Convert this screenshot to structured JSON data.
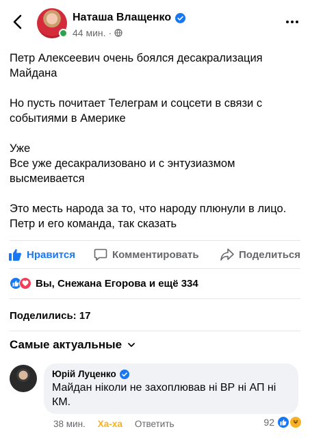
{
  "header": {
    "author": "Наташа Влащенко",
    "time": "44 мин.",
    "separator": "·",
    "icons": [
      "back-chevron-icon",
      "verified-badge-icon",
      "globe-icon",
      "more-dots-icon"
    ]
  },
  "post": {
    "paragraphs": [
      "Петр Алексеевич очень боялся десакрализация\nМайдана",
      "Но пусть почитает Телеграм и соцсети в связи с\nсобытиями в Америке",
      "Уже\nВсе уже десакрализовано и с энтузиазмом\nвысмеивается",
      "Это месть народа за то, что народу плюнули в лицо.\nПетр и его команда, так сказать"
    ]
  },
  "actions": {
    "like": "Нравится",
    "comment": "Комментировать",
    "share": "Поделиться"
  },
  "reactions": {
    "text": "Вы, Снежана Егорова и ещё 334",
    "icons": [
      "like-reaction-icon",
      "love-reaction-icon"
    ]
  },
  "shares": "Поделились: 17",
  "comments_sort": "Самые актуальные",
  "comment": {
    "author": "Юрій Луценко",
    "text": "Майдан ніколи не захоплював ні ВР ні АП ні КМ.",
    "time": "38 мин.",
    "haha": "Ха-ха",
    "reply": "Ответить",
    "reaction_count": "92"
  },
  "colors": {
    "accent": "#1877f2",
    "muted": "#65676b",
    "online": "#31a24c",
    "love": "#f33e58",
    "haha": "#f7b125",
    "bubble": "#f0f2f5"
  }
}
